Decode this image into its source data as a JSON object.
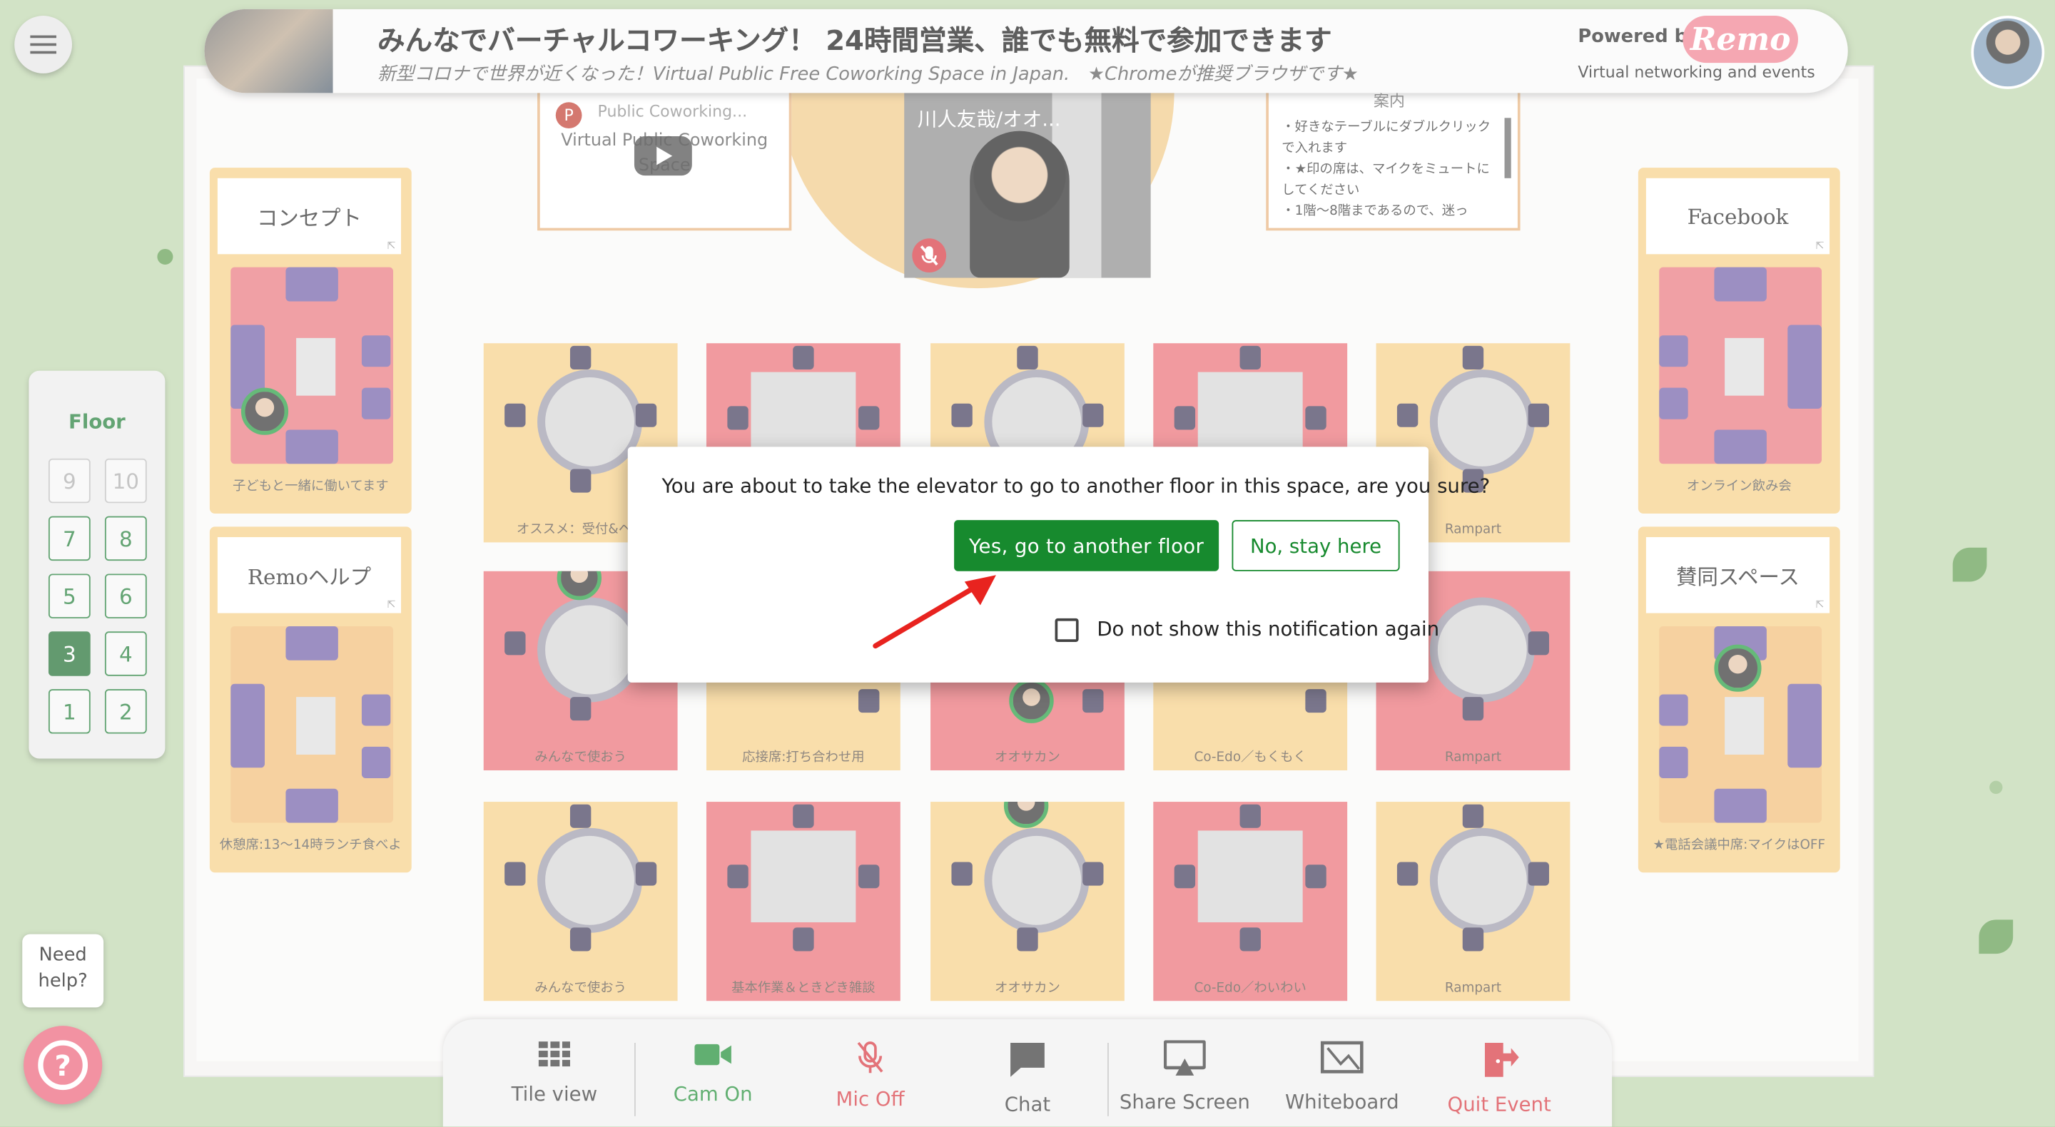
{
  "header": {
    "title": "みんなでバーチャルコワーキング！ 24時間営業、誰でも無料で参加できます",
    "subtitle": "新型コロナで世界が近くなった！Virtual Public Free Coworking Space in Japan.　★Chromeが推奨ブラウザです★",
    "powered_by": "Powered by",
    "brand": "Remo",
    "tagline": "Virtual networking and events"
  },
  "stage": {
    "youtube_title": "Public Coworking...",
    "youtube_text": "Virtual Public Coworking Space",
    "presenter_name": "川人友哉/オオ...",
    "notice_title": "案内",
    "notice_lines": [
      "・好きなテーブルにダブルクリックで入れます",
      "・★印の席は、マイクをミュートにしてください",
      "・1階〜8階まであるので、迷っ"
    ]
  },
  "side_rooms": {
    "left": [
      {
        "sign": "コンセプト",
        "caption": "子どもと一緒に働いてます"
      },
      {
        "sign": "Remoヘルプ",
        "caption": "休憩席:13〜14時ランチ食べよ"
      }
    ],
    "right": [
      {
        "sign": "Facebook",
        "caption": "オンライン飲み会"
      },
      {
        "sign": "賛同スペース",
        "caption": "★電話会議中席:マイクはOFF"
      }
    ]
  },
  "tables": {
    "row1": [
      "オススメ：受付&ヘル",
      "",
      "",
      "",
      "Rampart"
    ],
    "row2": [
      "みんなで使おう",
      "応接席:打ち合わせ用",
      "オオサカン",
      "Co-Edo／もくもく",
      "Rampart"
    ],
    "row3": [
      "みんなで使おう",
      "基本作業＆ときどき雑談",
      "オオサカン",
      "Co-Edo／わいわい",
      "Rampart"
    ]
  },
  "floor_panel": {
    "title": "Floor",
    "floors": [
      "9",
      "10",
      "7",
      "8",
      "5",
      "6",
      "3",
      "4",
      "1",
      "2"
    ],
    "current_floor": "3",
    "disabled_floors": [
      "9",
      "10"
    ]
  },
  "toolbar": {
    "tile_view": "Tile view",
    "cam": "Cam On",
    "mic": "Mic Off",
    "chat": "Chat",
    "share_screen": "Share Screen",
    "whiteboard": "Whiteboard",
    "quit": "Quit Event"
  },
  "help": {
    "bubble_line1": "Need",
    "bubble_line2": "help?"
  },
  "modal": {
    "message": "You are about to take the elevator to go to another floor in this space, are you sure?",
    "confirm_label": "Yes, go to another floor",
    "cancel_label": "No, stay here",
    "checkbox_label": "Do not show this notification again",
    "checkbox_checked": false
  },
  "colors": {
    "accent_green": "#178a2e",
    "mic_off_red": "#d6323a",
    "quit_red": "#d6323a",
    "remo_pink": "#f07e8e",
    "annotation_arrow": "#e8231f"
  }
}
